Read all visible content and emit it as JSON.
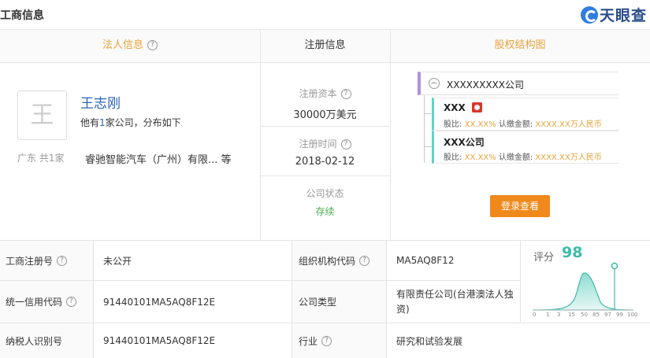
{
  "header": {
    "title": "工商信息",
    "logo_text": "天眼查"
  },
  "tabs": {
    "legal": "法人信息",
    "registration": "注册信息",
    "equity": "股权结构图"
  },
  "legal": {
    "avatar_char": "王",
    "name": "王志刚",
    "desc_prefix": "他有",
    "desc_count": "1",
    "desc_suffix": "家公司，分布如下",
    "region": "广东  共1家",
    "company": "睿驰智能汽车（广州）有限...  等"
  },
  "registration": {
    "capital_label": "注册资本",
    "capital_value": "30000万美元",
    "time_label": "注册时间",
    "time_value": "2018-02-12",
    "status_label": "公司状态",
    "status_value": "存续"
  },
  "equity": {
    "root": "XXXXXXXXX公司",
    "items": [
      {
        "name": "XXX",
        "ratio_label": "股比:",
        "ratio": "XX.XX%",
        "sub_label": "认缴金额:",
        "sub": "XXXX.XX万人民币"
      },
      {
        "name": "XXX公司",
        "ratio_label": "股比:",
        "ratio": "XX.XX%",
        "sub_label": "认缴金额:",
        "sub": "XXXX.XX万人民币"
      }
    ],
    "login_button": "登录查看"
  },
  "table": {
    "r1": {
      "l1": "工商注册号",
      "v1": "未公开",
      "l2": "组织机构代码",
      "v2": "MA5AQ8F12"
    },
    "r2": {
      "l1": "统一信用代码",
      "v1": "91440101MA5AQ8F12E",
      "l2": "公司类型",
      "v2": "有限责任公司(台港澳法人独资)"
    },
    "r3": {
      "l1": "纳税人识别号",
      "v1": "91440101MA5AQ8F12E",
      "l2": "行业",
      "v2": "研究和试验发展"
    }
  },
  "score": {
    "label": "评分",
    "value": 98,
    "axis": [
      "0",
      "1",
      "3",
      "15",
      "50",
      "85",
      "97",
      "99",
      "100"
    ],
    "accent": "#3dbba8"
  },
  "colors": {
    "tab_active": "#e8a33a",
    "link": "#2a64b5",
    "button": "#f0891c",
    "status": "#4caf50"
  }
}
